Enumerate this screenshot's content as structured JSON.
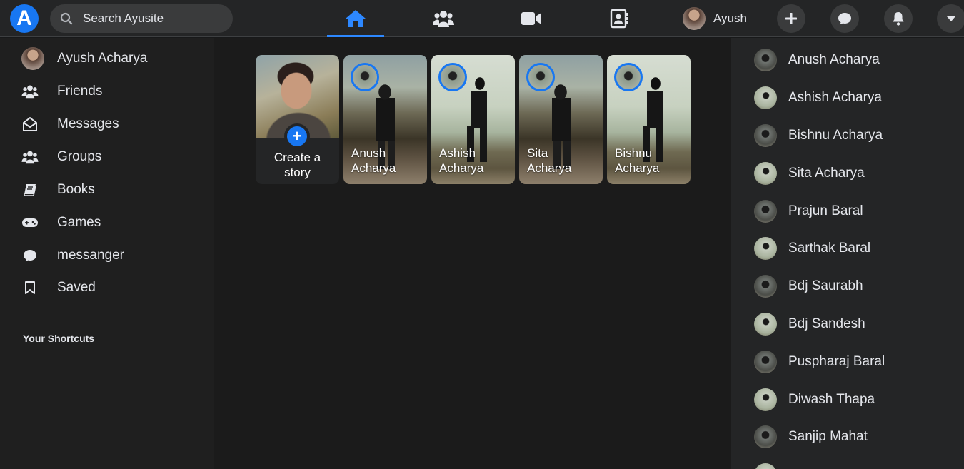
{
  "brand": {
    "logo_letter": "A",
    "accent": "#1877f2"
  },
  "search": {
    "placeholder": "Search Ayusite",
    "icon": "search-icon"
  },
  "nav_tabs": [
    {
      "name": "home",
      "icon": "home-icon",
      "active": true
    },
    {
      "name": "friends",
      "icon": "people-icon",
      "active": false
    },
    {
      "name": "watch",
      "icon": "video-icon",
      "active": false
    },
    {
      "name": "contacts",
      "icon": "contacts-icon",
      "active": false
    }
  ],
  "profile": {
    "name": "Ayush"
  },
  "actions": [
    {
      "name": "create",
      "icon": "plus-icon"
    },
    {
      "name": "messenger",
      "icon": "chat-icon"
    },
    {
      "name": "notifications",
      "icon": "bell-icon"
    },
    {
      "name": "account",
      "icon": "caret-down-icon"
    }
  ],
  "sidebar": {
    "items": [
      {
        "label": "Ayush Acharya",
        "icon": "avatar"
      },
      {
        "label": "Friends",
        "icon": "people-icon"
      },
      {
        "label": "Messages",
        "icon": "envelope-open-icon"
      },
      {
        "label": "Groups",
        "icon": "people-icon"
      },
      {
        "label": "Books",
        "icon": "book-icon"
      },
      {
        "label": "Games",
        "icon": "gamepad-icon"
      },
      {
        "label": "messanger",
        "icon": "chat-icon"
      },
      {
        "label": "Saved",
        "icon": "bookmark-icon"
      }
    ],
    "shortcuts_title": "Your Shortcuts"
  },
  "stories": {
    "create": {
      "line1": "Create a",
      "line2": "story"
    },
    "items": [
      {
        "first": "Anush",
        "last": "Acharya",
        "variant": "a"
      },
      {
        "first": "Ashish",
        "last": "Acharya",
        "variant": "b"
      },
      {
        "first": "Sita",
        "last": "Acharya",
        "variant": "a"
      },
      {
        "first": "Bishnu",
        "last": "Acharya",
        "variant": "b"
      }
    ]
  },
  "contacts": [
    {
      "name": "Anush Acharya",
      "avatar": "dark"
    },
    {
      "name": "Ashish Acharya",
      "avatar": "light"
    },
    {
      "name": "Bishnu Acharya",
      "avatar": "dark"
    },
    {
      "name": "Sita Acharya",
      "avatar": "light"
    },
    {
      "name": "Prajun Baral",
      "avatar": "dark"
    },
    {
      "name": "Sarthak Baral",
      "avatar": "light"
    },
    {
      "name": "Bdj Saurabh",
      "avatar": "dark"
    },
    {
      "name": "Bdj Sandesh",
      "avatar": "light"
    },
    {
      "name": "Puspharaj Baral",
      "avatar": "dark"
    },
    {
      "name": "Diwash Thapa",
      "avatar": "light"
    },
    {
      "name": "Sanjip Mahat",
      "avatar": "dark"
    }
  ]
}
